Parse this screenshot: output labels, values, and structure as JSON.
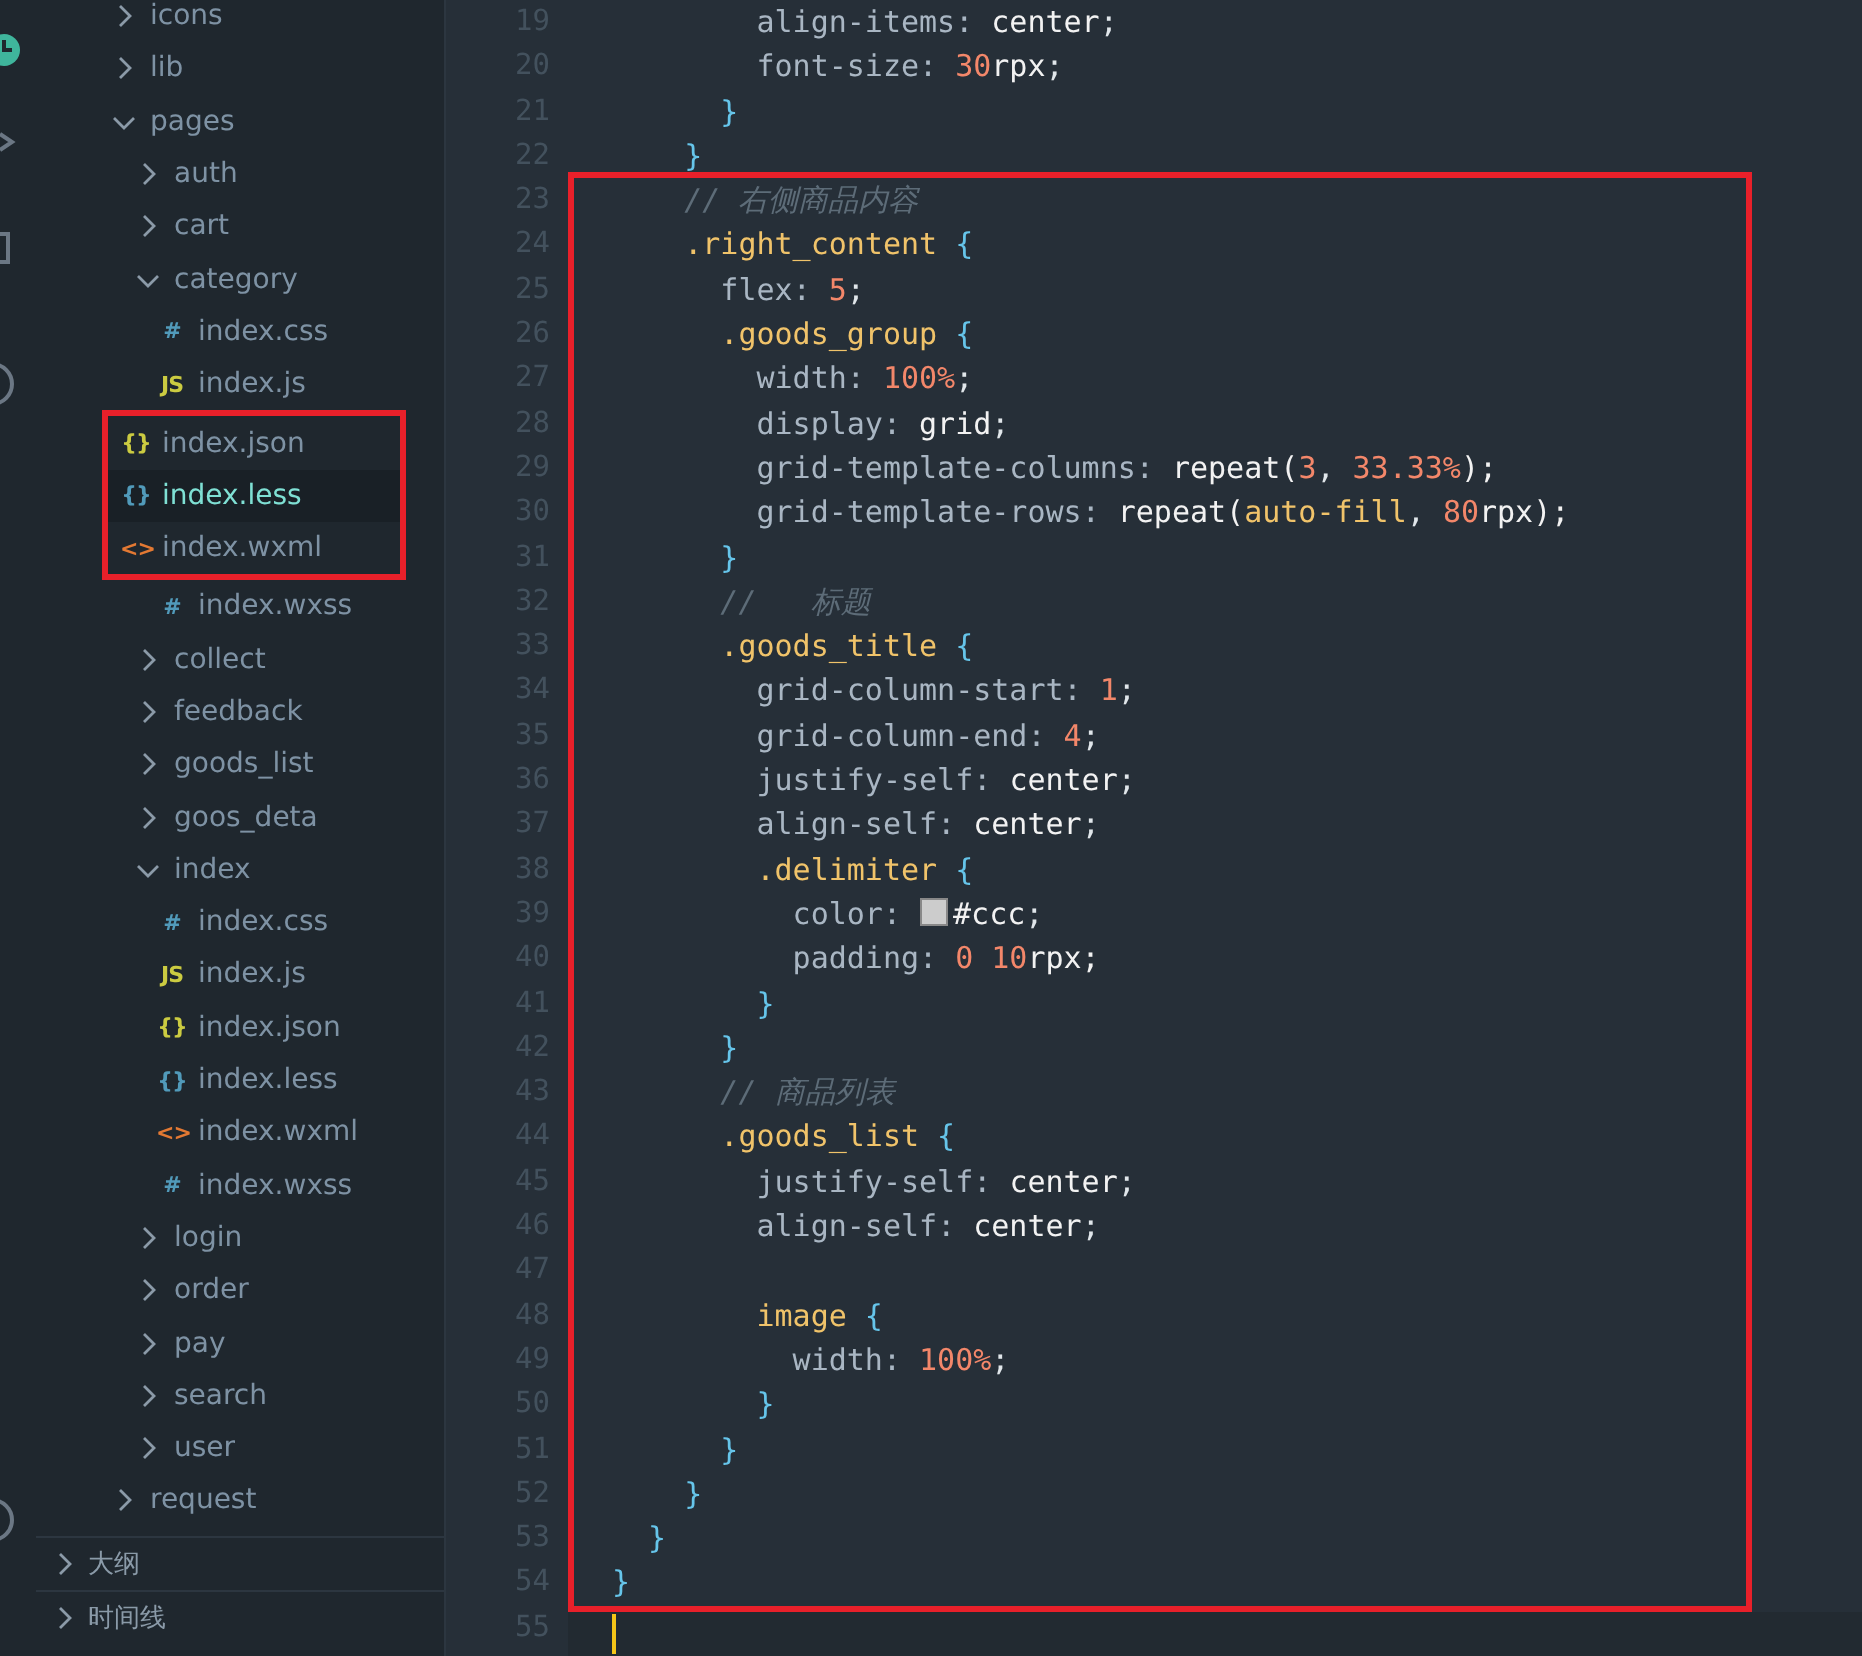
{
  "explorer": {
    "items": [
      {
        "label": "icons",
        "kind": "folder",
        "expanded": false,
        "selected": false
      },
      {
        "label": "lib",
        "kind": "folder",
        "expanded": false,
        "selected": false
      },
      {
        "label": "pages",
        "kind": "folder",
        "expanded": true,
        "selected": false,
        "children": [
          {
            "label": "auth",
            "kind": "folder",
            "expanded": false,
            "selected": false
          },
          {
            "label": "cart",
            "kind": "folder",
            "expanded": false,
            "selected": false
          },
          {
            "label": "category",
            "kind": "folder",
            "expanded": true,
            "selected": false,
            "children": [
              {
                "label": "index.css",
                "kind": "css",
                "icon": "#",
                "selected": false,
                "highlighted": false
              },
              {
                "label": "index.js",
                "kind": "js",
                "icon": "JS",
                "selected": false,
                "highlighted": false
              },
              {
                "label": "index.json",
                "kind": "json",
                "icon": "{}",
                "selected": false,
                "highlighted": true
              },
              {
                "label": "index.less",
                "kind": "less",
                "icon": "{}",
                "selected": true,
                "highlighted": true
              },
              {
                "label": "index.wxml",
                "kind": "wxml",
                "icon": "<>",
                "selected": false,
                "highlighted": true
              },
              {
                "label": "index.wxss",
                "kind": "css",
                "icon": "#",
                "selected": false,
                "highlighted": false
              }
            ]
          },
          {
            "label": "collect",
            "kind": "folder",
            "expanded": false,
            "selected": false
          },
          {
            "label": "feedback",
            "kind": "folder",
            "expanded": false,
            "selected": false
          },
          {
            "label": "goods_list",
            "kind": "folder",
            "expanded": false,
            "selected": false
          },
          {
            "label": "goos_deta",
            "kind": "folder",
            "expanded": false,
            "selected": false
          },
          {
            "label": "index",
            "kind": "folder",
            "expanded": true,
            "selected": false,
            "children": [
              {
                "label": "index.css",
                "kind": "css",
                "icon": "#",
                "selected": false,
                "highlighted": false
              },
              {
                "label": "index.js",
                "kind": "js",
                "icon": "JS",
                "selected": false,
                "highlighted": false
              },
              {
                "label": "index.json",
                "kind": "json",
                "icon": "{}",
                "selected": false,
                "highlighted": false
              },
              {
                "label": "index.less",
                "kind": "less",
                "icon": "{}",
                "selected": false,
                "highlighted": false
              },
              {
                "label": "index.wxml",
                "kind": "wxml",
                "icon": "<>",
                "selected": false,
                "highlighted": false
              },
              {
                "label": "index.wxss",
                "kind": "css",
                "icon": "#",
                "selected": false,
                "highlighted": false
              }
            ]
          },
          {
            "label": "login",
            "kind": "folder",
            "expanded": false,
            "selected": false
          },
          {
            "label": "order",
            "kind": "folder",
            "expanded": false,
            "selected": false
          },
          {
            "label": "pay",
            "kind": "folder",
            "expanded": false,
            "selected": false
          },
          {
            "label": "search",
            "kind": "folder",
            "expanded": false,
            "selected": false
          },
          {
            "label": "user",
            "kind": "folder",
            "expanded": false,
            "selected": false
          }
        ]
      },
      {
        "label": "request",
        "kind": "folder",
        "expanded": false,
        "selected": false
      }
    ]
  },
  "panels": [
    {
      "label": "大纲",
      "expanded": false
    },
    {
      "label": "时间线",
      "expanded": false
    }
  ],
  "editor": {
    "lines": [
      {
        "number": "19",
        "highlighted": false,
        "cursor": false,
        "tokens": [
          {
            "kind": "prop",
            "text": "        align-items"
          },
          {
            "kind": "colon",
            "text": ": "
          },
          {
            "kind": "val",
            "text": "center"
          },
          {
            "kind": "punct",
            "text": ";"
          }
        ]
      },
      {
        "number": "20",
        "highlighted": false,
        "cursor": false,
        "tokens": [
          {
            "kind": "prop",
            "text": "        font-size"
          },
          {
            "kind": "colon",
            "text": ": "
          },
          {
            "kind": "num",
            "text": "30"
          },
          {
            "kind": "val",
            "text": "rpx"
          },
          {
            "kind": "punct",
            "text": ";"
          }
        ]
      },
      {
        "number": "21",
        "highlighted": false,
        "cursor": false,
        "tokens": [
          {
            "kind": "brace",
            "text": "      }"
          }
        ]
      },
      {
        "number": "22",
        "highlighted": false,
        "cursor": false,
        "tokens": [
          {
            "kind": "brace",
            "text": "    }"
          }
        ]
      },
      {
        "number": "23",
        "highlighted": true,
        "cursor": false,
        "tokens": [
          {
            "kind": "comment",
            "text": "    // 右侧商品内容"
          }
        ]
      },
      {
        "number": "24",
        "highlighted": true,
        "cursor": false,
        "tokens": [
          {
            "kind": "sel",
            "text": "    .right_content"
          },
          {
            "kind": "brace",
            "text": " {"
          }
        ]
      },
      {
        "number": "25",
        "highlighted": true,
        "cursor": false,
        "tokens": [
          {
            "kind": "prop",
            "text": "      flex"
          },
          {
            "kind": "colon",
            "text": ": "
          },
          {
            "kind": "num",
            "text": "5"
          },
          {
            "kind": "punct",
            "text": ";"
          }
        ]
      },
      {
        "number": "26",
        "highlighted": true,
        "cursor": false,
        "tokens": [
          {
            "kind": "sel",
            "text": "      .goods_group"
          },
          {
            "kind": "brace",
            "text": " {"
          }
        ]
      },
      {
        "number": "27",
        "highlighted": true,
        "cursor": false,
        "tokens": [
          {
            "kind": "prop",
            "text": "        width"
          },
          {
            "kind": "colon",
            "text": ": "
          },
          {
            "kind": "num",
            "text": "100%"
          },
          {
            "kind": "punct",
            "text": ";"
          }
        ]
      },
      {
        "number": "28",
        "highlighted": true,
        "cursor": false,
        "tokens": [
          {
            "kind": "prop",
            "text": "        display"
          },
          {
            "kind": "colon",
            "text": ": "
          },
          {
            "kind": "val",
            "text": "grid"
          },
          {
            "kind": "punct",
            "text": ";"
          }
        ]
      },
      {
        "number": "29",
        "highlighted": true,
        "cursor": false,
        "tokens": [
          {
            "kind": "prop",
            "text": "        grid-template-columns"
          },
          {
            "kind": "colon",
            "text": ": "
          },
          {
            "kind": "val",
            "text": "repeat("
          },
          {
            "kind": "num",
            "text": "3"
          },
          {
            "kind": "punct",
            "text": ", "
          },
          {
            "kind": "num",
            "text": "33.33%"
          },
          {
            "kind": "val",
            "text": ");"
          }
        ]
      },
      {
        "number": "30",
        "highlighted": true,
        "cursor": false,
        "tokens": [
          {
            "kind": "prop",
            "text": "        grid-template-rows"
          },
          {
            "kind": "colon",
            "text": ": "
          },
          {
            "kind": "val",
            "text": "repeat("
          },
          {
            "kind": "kw",
            "text": "auto-fill"
          },
          {
            "kind": "punct",
            "text": ", "
          },
          {
            "kind": "num",
            "text": "80"
          },
          {
            "kind": "val",
            "text": "rpx);"
          }
        ]
      },
      {
        "number": "31",
        "highlighted": true,
        "cursor": false,
        "tokens": [
          {
            "kind": "brace",
            "text": "      }"
          }
        ]
      },
      {
        "number": "32",
        "highlighted": true,
        "cursor": false,
        "tokens": [
          {
            "kind": "comment",
            "text": "      //   标题"
          }
        ]
      },
      {
        "number": "33",
        "highlighted": true,
        "cursor": false,
        "tokens": [
          {
            "kind": "sel",
            "text": "      .goods_title"
          },
          {
            "kind": "brace",
            "text": " {"
          }
        ]
      },
      {
        "number": "34",
        "highlighted": true,
        "cursor": false,
        "tokens": [
          {
            "kind": "prop",
            "text": "        grid-column-start"
          },
          {
            "kind": "colon",
            "text": ": "
          },
          {
            "kind": "num",
            "text": "1"
          },
          {
            "kind": "punct",
            "text": ";"
          }
        ]
      },
      {
        "number": "35",
        "highlighted": true,
        "cursor": false,
        "tokens": [
          {
            "kind": "prop",
            "text": "        grid-column-end"
          },
          {
            "kind": "colon",
            "text": ": "
          },
          {
            "kind": "num",
            "text": "4"
          },
          {
            "kind": "punct",
            "text": ";"
          }
        ]
      },
      {
        "number": "36",
        "highlighted": true,
        "cursor": false,
        "tokens": [
          {
            "kind": "prop",
            "text": "        justify-self"
          },
          {
            "kind": "colon",
            "text": ": "
          },
          {
            "kind": "val",
            "text": "center"
          },
          {
            "kind": "punct",
            "text": ";"
          }
        ]
      },
      {
        "number": "37",
        "highlighted": true,
        "cursor": false,
        "tokens": [
          {
            "kind": "prop",
            "text": "        align-self"
          },
          {
            "kind": "colon",
            "text": ": "
          },
          {
            "kind": "val",
            "text": "center"
          },
          {
            "kind": "punct",
            "text": ";"
          }
        ]
      },
      {
        "number": "38",
        "highlighted": true,
        "cursor": false,
        "tokens": [
          {
            "kind": "sel",
            "text": "        .delimiter"
          },
          {
            "kind": "brace",
            "text": " {"
          }
        ]
      },
      {
        "number": "39",
        "highlighted": true,
        "cursor": false,
        "tokens": [
          {
            "kind": "prop",
            "text": "          color"
          },
          {
            "kind": "colon",
            "text": ": "
          },
          {
            "kind": "swatch",
            "color": "#cccccc"
          },
          {
            "kind": "val",
            "text": "#ccc"
          },
          {
            "kind": "punct",
            "text": ";"
          }
        ]
      },
      {
        "number": "40",
        "highlighted": true,
        "cursor": false,
        "tokens": [
          {
            "kind": "prop",
            "text": "          padding"
          },
          {
            "kind": "colon",
            "text": ": "
          },
          {
            "kind": "num",
            "text": "0 10"
          },
          {
            "kind": "val",
            "text": "rpx;"
          }
        ]
      },
      {
        "number": "41",
        "highlighted": true,
        "cursor": false,
        "tokens": [
          {
            "kind": "brace",
            "text": "        }"
          }
        ]
      },
      {
        "number": "42",
        "highlighted": true,
        "cursor": false,
        "tokens": [
          {
            "kind": "brace",
            "text": "      }"
          }
        ]
      },
      {
        "number": "43",
        "highlighted": true,
        "cursor": false,
        "tokens": [
          {
            "kind": "comment",
            "text": "      // 商品列表"
          }
        ]
      },
      {
        "number": "44",
        "highlighted": true,
        "cursor": false,
        "tokens": [
          {
            "kind": "sel",
            "text": "      .goods_list"
          },
          {
            "kind": "brace",
            "text": " {"
          }
        ]
      },
      {
        "number": "45",
        "highlighted": true,
        "cursor": false,
        "tokens": [
          {
            "kind": "prop",
            "text": "        justify-self"
          },
          {
            "kind": "colon",
            "text": ": "
          },
          {
            "kind": "val",
            "text": "center"
          },
          {
            "kind": "punct",
            "text": ";"
          }
        ]
      },
      {
        "number": "46",
        "highlighted": true,
        "cursor": false,
        "tokens": [
          {
            "kind": "prop",
            "text": "        align-self"
          },
          {
            "kind": "colon",
            "text": ": "
          },
          {
            "kind": "val",
            "text": "center"
          },
          {
            "kind": "punct",
            "text": ";"
          }
        ]
      },
      {
        "number": "47",
        "highlighted": true,
        "cursor": false
      },
      {
        "number": "48",
        "highlighted": true,
        "cursor": false,
        "tokens": [
          {
            "kind": "sel",
            "text": "        image"
          },
          {
            "kind": "brace",
            "text": " {"
          }
        ]
      },
      {
        "number": "49",
        "highlighted": true,
        "cursor": false,
        "tokens": [
          {
            "kind": "prop",
            "text": "          width"
          },
          {
            "kind": "colon",
            "text": ": "
          },
          {
            "kind": "num",
            "text": "100%"
          },
          {
            "kind": "punct",
            "text": ";"
          }
        ]
      },
      {
        "number": "50",
        "highlighted": true,
        "cursor": false,
        "tokens": [
          {
            "kind": "brace",
            "text": "        }"
          }
        ]
      },
      {
        "number": "51",
        "highlighted": true,
        "cursor": false,
        "tokens": [
          {
            "kind": "brace",
            "text": "      }"
          }
        ]
      },
      {
        "number": "52",
        "highlighted": true,
        "cursor": false,
        "tokens": [
          {
            "kind": "brace",
            "text": "    }"
          }
        ]
      },
      {
        "number": "53",
        "highlighted": true,
        "cursor": false,
        "tokens": [
          {
            "kind": "brace",
            "text": "  }"
          }
        ]
      },
      {
        "number": "54",
        "highlighted": true,
        "cursor": false,
        "tokens": [
          {
            "kind": "brace",
            "text": "}"
          }
        ]
      },
      {
        "number": "55",
        "highlighted": false,
        "cursor": true
      }
    ]
  }
}
